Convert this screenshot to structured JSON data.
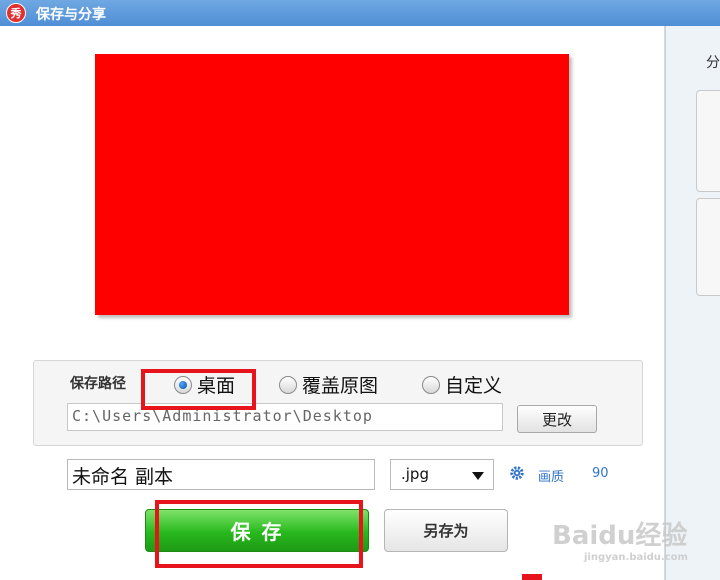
{
  "window": {
    "title": "保存与分享",
    "app_icon_text": "秀"
  },
  "share_panel": {
    "label": "分"
  },
  "path_section": {
    "label": "保存路径",
    "options": [
      {
        "label": "桌面",
        "selected": true
      },
      {
        "label": "覆盖原图",
        "selected": false
      },
      {
        "label": "自定义",
        "selected": false
      }
    ],
    "path_value": "C:\\Users\\Administrator\\Desktop",
    "change_label": "更改"
  },
  "file": {
    "name_value": "未命名 副本",
    "format_selected": ".jpg",
    "quality_label": "画质",
    "quality_value": "90"
  },
  "actions": {
    "save_label": "保 存",
    "save_as_label": "另存为"
  },
  "watermark": {
    "brand": "Baidu经验",
    "url": "jingyan.baidu.com"
  },
  "colors": {
    "preview_fill": "#ff0000",
    "title_bar": "#5a97da",
    "save_button": "#2cbc20",
    "highlight": "#e8141c",
    "link": "#2f73c9"
  }
}
